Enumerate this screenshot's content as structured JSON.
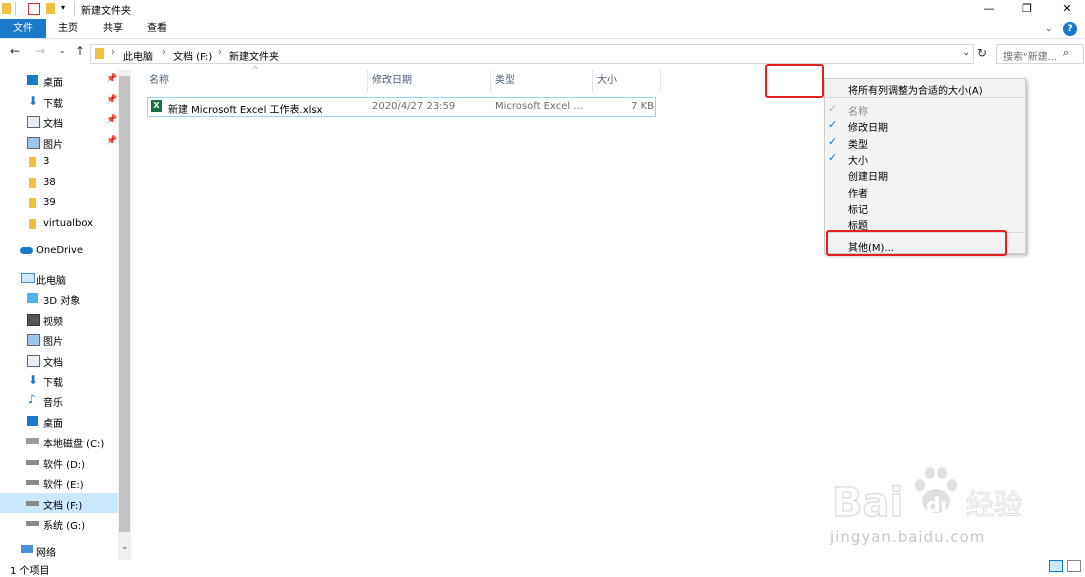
{
  "window": {
    "title": "新建文件夹",
    "controls": {
      "minimize": "—",
      "maximize": "❐",
      "close": "✕"
    }
  },
  "ribbon": {
    "tabs": [
      "文件",
      "主页",
      "共享",
      "查看"
    ],
    "help": "?"
  },
  "address": {
    "breadcrumb": [
      "此电脑",
      "文档 (F:)",
      "新建文件夹"
    ],
    "search_placeholder": "搜索\"新建..."
  },
  "nav": {
    "quick_access": [
      {
        "label": "桌面",
        "icon": "desktop-icon",
        "pinned": true
      },
      {
        "label": "下载",
        "icon": "download-icon",
        "pinned": true
      },
      {
        "label": "文档",
        "icon": "document-icon",
        "pinned": true
      },
      {
        "label": "图片",
        "icon": "picture-icon",
        "pinned": true
      },
      {
        "label": "3",
        "icon": "folder-icon",
        "pinned": false
      },
      {
        "label": "38",
        "icon": "folder-icon",
        "pinned": false
      },
      {
        "label": "39",
        "icon": "folder-icon",
        "pinned": false
      },
      {
        "label": "virtualbox",
        "icon": "folder-icon",
        "pinned": false
      }
    ],
    "onedrive": "OneDrive",
    "this_pc": "此电脑",
    "this_pc_items": [
      "3D 对象",
      "视频",
      "图片",
      "文档",
      "下载",
      "音乐",
      "桌面",
      "本地磁盘 (C:)",
      "软件 (D:)",
      "软件 (E:)",
      "文档 (F:)",
      "系统 (G:)"
    ],
    "network": "网络"
  },
  "columns": [
    "名称",
    "修改日期",
    "类型",
    "大小"
  ],
  "files": [
    {
      "name": "新建 Microsoft Excel 工作表.xlsx",
      "modified": "2020/4/27 23:59",
      "type": "Microsoft Excel ...",
      "size": "7 KB"
    }
  ],
  "context_menu": {
    "fit_all": "将所有列调整为合适的大小(A)",
    "items": [
      {
        "label": "名称",
        "checked": true,
        "disabled": true
      },
      {
        "label": "修改日期",
        "checked": true,
        "disabled": false
      },
      {
        "label": "类型",
        "checked": true,
        "disabled": false
      },
      {
        "label": "大小",
        "checked": true,
        "disabled": false
      },
      {
        "label": "创建日期",
        "checked": false,
        "disabled": false
      },
      {
        "label": "作者",
        "checked": false,
        "disabled": false
      },
      {
        "label": "标记",
        "checked": false,
        "disabled": false
      },
      {
        "label": "标题",
        "checked": false,
        "disabled": false
      }
    ],
    "more": "其他(M)..."
  },
  "status": {
    "count": "1 个项目"
  },
  "watermark": {
    "brand_text": "Bai du 经验",
    "url": "jingyan.baidu.com"
  },
  "colors": {
    "accent": "#1979ca",
    "highlight": "#e12121",
    "selection": "#cce8ff"
  }
}
